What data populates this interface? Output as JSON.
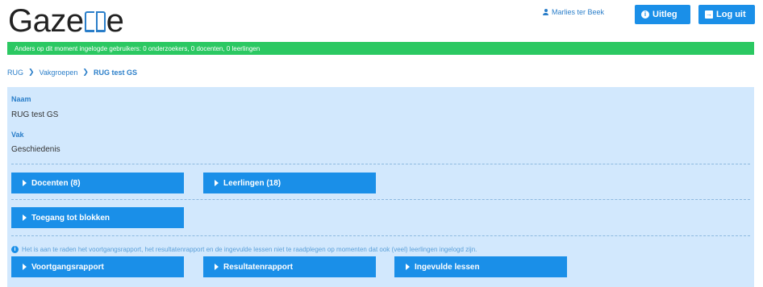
{
  "header": {
    "logo_text_start": "Gaze",
    "logo_text_end": "e",
    "user_name": "Marlies ter Beek",
    "uitleg_label": "Uitleg",
    "logout_label": "Log uit"
  },
  "notice": {
    "text": "Anders op dit moment ingelogde gebruikers: 0 onderzoekers, 0 docenten, 0 leerlingen"
  },
  "breadcrumb": {
    "items": [
      "RUG",
      "Vakgroepen",
      "RUG test GS"
    ]
  },
  "details": {
    "naam_label": "Naam",
    "naam_value": "RUG test GS",
    "vak_label": "Vak",
    "vak_value": "Geschiedenis"
  },
  "sections": {
    "docenten": "Docenten (8)",
    "leerlingen": "Leerlingen (18)",
    "toegang": "Toegang tot blokken"
  },
  "info_text": "Het is aan te raden het voortgangsrapport, het resultatenrapport en de ingevulde lessen niet te raadplegen op momenten dat ook (veel) leerlingen ingelogd zijn.",
  "reports": {
    "voortgang": "Voortgangsrapport",
    "resultaten": "Resultatenrapport",
    "ingevuld": "Ingevulde lessen"
  },
  "colors": {
    "brand_blue": "#1a8fe8",
    "link_blue": "#2a7ec9",
    "notice_green": "#2bc862",
    "panel_bg": "#d2e8fd"
  }
}
